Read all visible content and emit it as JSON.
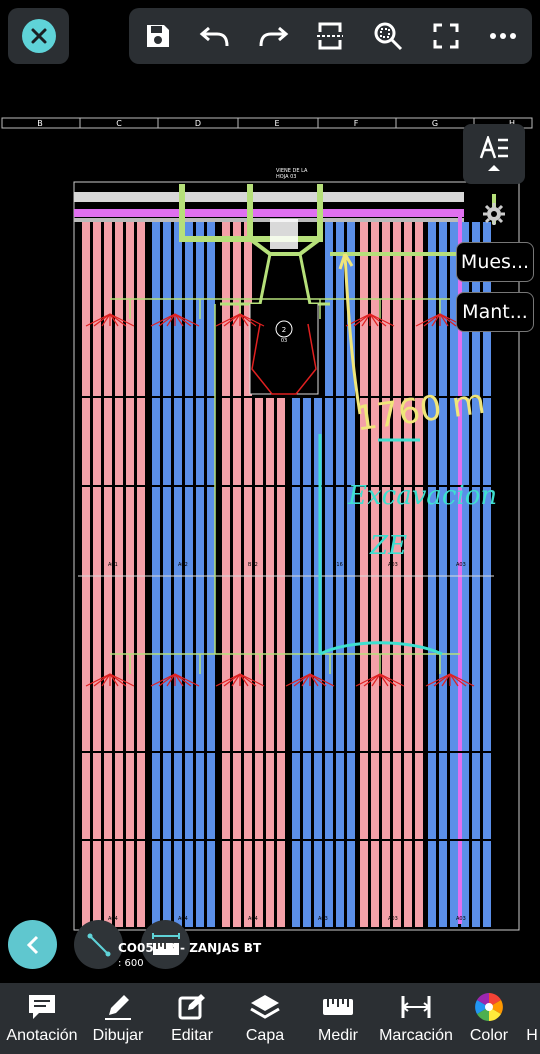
{
  "toolbar": {
    "close": "close-icon",
    "actions": [
      "save-icon",
      "undo-icon",
      "redo-icon",
      "fit-width-icon",
      "zoom-search-icon",
      "fullscreen-icon",
      "more-icon"
    ]
  },
  "drawing": {
    "columns": [
      "B",
      "C",
      "D",
      "E",
      "F",
      "G",
      "H"
    ],
    "header_note_line1": "VIENE DE LA",
    "header_note_line2": "HOJA 03",
    "station_number": "2",
    "station_sub": "03",
    "block_labels": [
      "A01",
      "A02",
      "B12",
      "B16",
      "A03",
      "A03",
      "A04",
      "A04",
      "A04",
      "A03",
      "A03",
      "A03"
    ],
    "handwriting_line1": "1760 m",
    "handwriting_line2": "Excavacion",
    "handwriting_line3": "ZE"
  },
  "side_panel": {
    "style_button": "text-style-icon",
    "mues_label": "Mues...",
    "mant_label": "Mant..."
  },
  "sheet": {
    "title": "CO05 · R - ZANJAS BT",
    "scale": ": 600"
  },
  "tabs": [
    {
      "label": "Anotación",
      "icon": "annotation-icon"
    },
    {
      "label": "Dibujar",
      "icon": "pencil-icon"
    },
    {
      "label": "Editar",
      "icon": "edit-icon"
    },
    {
      "label": "Capa",
      "icon": "layers-icon"
    },
    {
      "label": "Medir",
      "icon": "ruler-icon"
    },
    {
      "label": "Marcación",
      "icon": "dimension-icon"
    },
    {
      "label": "Color",
      "icon": "color-wheel-icon"
    },
    {
      "label": "H",
      "icon": ""
    }
  ],
  "colors": {
    "accent": "#5fd3d8",
    "panel": "#2b2f33",
    "pink": "#f4a0a8",
    "blue": "#5b8fe8",
    "green_line": "#b6e07a",
    "yellow_ink": "#f0e67a",
    "cyan_ink": "#3ee0d0",
    "red_lines": "#e02020",
    "magenta": "#e070f0"
  }
}
